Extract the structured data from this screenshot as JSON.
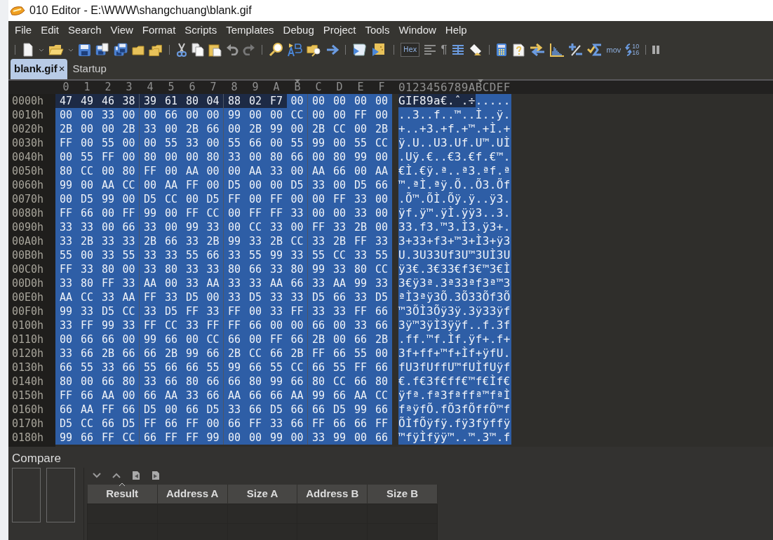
{
  "window": {
    "title": "010 Editor - E:\\WWW\\shangchuang\\blank.gif"
  },
  "menu": [
    "File",
    "Edit",
    "Search",
    "View",
    "Format",
    "Scripts",
    "Templates",
    "Debug",
    "Project",
    "Tools",
    "Window",
    "Help"
  ],
  "toolbar": {
    "hex_toggle": {
      "label": "Hex",
      "on": true
    },
    "pilcrow": "¶",
    "mov_label": "mov",
    "base_labels": [
      "10",
      "16"
    ]
  },
  "tabs": [
    {
      "label": "blank.gif",
      "selected": true,
      "close": "×"
    },
    {
      "label": "Startup",
      "selected": false
    }
  ],
  "hex_view": {
    "selected": true,
    "column_headers": [
      {
        "label": "0",
        "cursor": false
      },
      {
        "label": "1",
        "cursor": false
      },
      {
        "label": "2",
        "cursor": false
      },
      {
        "label": "3",
        "cursor": false
      },
      {
        "label": "4",
        "cursor": false
      },
      {
        "label": "5",
        "cursor": false
      },
      {
        "label": "6",
        "cursor": false
      },
      {
        "label": "7",
        "cursor": false
      },
      {
        "label": "8",
        "cursor": false
      },
      {
        "label": "9",
        "cursor": false
      },
      {
        "label": "A",
        "cursor": false
      },
      {
        "label": "B",
        "cursor": true
      },
      {
        "label": "C",
        "cursor": false
      },
      {
        "label": "D",
        "cursor": false
      },
      {
        "label": "E",
        "cursor": false
      },
      {
        "label": "F",
        "cursor": false
      }
    ],
    "ascii_header": "0123456789ABCDEF",
    "rows": [
      {
        "offset": "0000h",
        "marked_bytes": [
          "47",
          "49",
          "46",
          "38",
          "39",
          "61",
          "80",
          "04",
          "88",
          "02",
          "F7"
        ],
        "bytes": [
          "00",
          "00",
          "00",
          "00",
          "00"
        ],
        "ascii_marked": "GIF89a€.ˆ.÷",
        "ascii": "....."
      },
      {
        "offset": "0010h",
        "bytes": [
          "00",
          "00",
          "33",
          "00",
          "00",
          "66",
          "00",
          "00",
          "99",
          "00",
          "00",
          "CC",
          "00",
          "00",
          "FF",
          "00"
        ],
        "ascii": "..3..f..™..Ì..ÿ."
      },
      {
        "offset": "0020h",
        "bytes": [
          "2B",
          "00",
          "00",
          "2B",
          "33",
          "00",
          "2B",
          "66",
          "00",
          "2B",
          "99",
          "00",
          "2B",
          "CC",
          "00",
          "2B"
        ],
        "ascii": "+..+3.+f.+™.+Ì.+"
      },
      {
        "offset": "0030h",
        "bytes": [
          "FF",
          "00",
          "55",
          "00",
          "00",
          "55",
          "33",
          "00",
          "55",
          "66",
          "00",
          "55",
          "99",
          "00",
          "55",
          "CC"
        ],
        "ascii": "ÿ.U..U3.Uf.U™.UÌ"
      },
      {
        "offset": "0040h",
        "bytes": [
          "00",
          "55",
          "FF",
          "00",
          "80",
          "00",
          "00",
          "80",
          "33",
          "00",
          "80",
          "66",
          "00",
          "80",
          "99",
          "00"
        ],
        "ascii": ".Uÿ.€..€3.€f.€™."
      },
      {
        "offset": "0050h",
        "bytes": [
          "80",
          "CC",
          "00",
          "80",
          "FF",
          "00",
          "AA",
          "00",
          "00",
          "AA",
          "33",
          "00",
          "AA",
          "66",
          "00",
          "AA"
        ],
        "ascii": "€Ì.€ÿ.ª..ª3.ªf.ª"
      },
      {
        "offset": "0060h",
        "bytes": [
          "99",
          "00",
          "AA",
          "CC",
          "00",
          "AA",
          "FF",
          "00",
          "D5",
          "00",
          "00",
          "D5",
          "33",
          "00",
          "D5",
          "66"
        ],
        "ascii": "™.ªÌ.ªÿ.Õ..Õ3.Õf"
      },
      {
        "offset": "0070h",
        "bytes": [
          "00",
          "D5",
          "99",
          "00",
          "D5",
          "CC",
          "00",
          "D5",
          "FF",
          "00",
          "FF",
          "00",
          "00",
          "FF",
          "33",
          "00"
        ],
        "ascii": ".Õ™.ÕÌ.Õÿ.ÿ..ÿ3."
      },
      {
        "offset": "0080h",
        "bytes": [
          "FF",
          "66",
          "00",
          "FF",
          "99",
          "00",
          "FF",
          "CC",
          "00",
          "FF",
          "FF",
          "33",
          "00",
          "00",
          "33",
          "00"
        ],
        "ascii": "ÿf.ÿ™.ÿÌ.ÿÿ3..3."
      },
      {
        "offset": "0090h",
        "bytes": [
          "33",
          "33",
          "00",
          "66",
          "33",
          "00",
          "99",
          "33",
          "00",
          "CC",
          "33",
          "00",
          "FF",
          "33",
          "2B",
          "00"
        ],
        "ascii": "33.f3.™3.Ì3.ÿ3+."
      },
      {
        "offset": "00A0h",
        "bytes": [
          "33",
          "2B",
          "33",
          "33",
          "2B",
          "66",
          "33",
          "2B",
          "99",
          "33",
          "2B",
          "CC",
          "33",
          "2B",
          "FF",
          "33"
        ],
        "ascii": "3+33+f3+™3+Ì3+ÿ3"
      },
      {
        "offset": "00B0h",
        "bytes": [
          "55",
          "00",
          "33",
          "55",
          "33",
          "33",
          "55",
          "66",
          "33",
          "55",
          "99",
          "33",
          "55",
          "CC",
          "33",
          "55"
        ],
        "ascii": "U.3U33Uf3U™3UÌ3U"
      },
      {
        "offset": "00C0h",
        "bytes": [
          "FF",
          "33",
          "80",
          "00",
          "33",
          "80",
          "33",
          "33",
          "80",
          "66",
          "33",
          "80",
          "99",
          "33",
          "80",
          "CC"
        ],
        "ascii": "ÿ3€.3€33€f3€™3€Ì"
      },
      {
        "offset": "00D0h",
        "bytes": [
          "33",
          "80",
          "FF",
          "33",
          "AA",
          "00",
          "33",
          "AA",
          "33",
          "33",
          "AA",
          "66",
          "33",
          "AA",
          "99",
          "33"
        ],
        "ascii": "3€ÿ3ª.3ª33ªf3ª™3"
      },
      {
        "offset": "00E0h",
        "bytes": [
          "AA",
          "CC",
          "33",
          "AA",
          "FF",
          "33",
          "D5",
          "00",
          "33",
          "D5",
          "33",
          "33",
          "D5",
          "66",
          "33",
          "D5"
        ],
        "ascii": "ªÌ3ªÿ3Õ.3Õ33Õf3Õ"
      },
      {
        "offset": "00F0h",
        "bytes": [
          "99",
          "33",
          "D5",
          "CC",
          "33",
          "D5",
          "FF",
          "33",
          "FF",
          "00",
          "33",
          "FF",
          "33",
          "33",
          "FF",
          "66"
        ],
        "ascii": "™3ÕÌ3Õÿ3ÿ.3ÿ33ÿf"
      },
      {
        "offset": "0100h",
        "bytes": [
          "33",
          "FF",
          "99",
          "33",
          "FF",
          "CC",
          "33",
          "FF",
          "FF",
          "66",
          "00",
          "00",
          "66",
          "00",
          "33",
          "66"
        ],
        "ascii": "3ÿ™3ÿÌ3ÿÿf..f.3f"
      },
      {
        "offset": "0110h",
        "bytes": [
          "00",
          "66",
          "66",
          "00",
          "99",
          "66",
          "00",
          "CC",
          "66",
          "00",
          "FF",
          "66",
          "2B",
          "00",
          "66",
          "2B"
        ],
        "ascii": ".ff.™f.Ìf.ÿf+.f+"
      },
      {
        "offset": "0120h",
        "bytes": [
          "33",
          "66",
          "2B",
          "66",
          "66",
          "2B",
          "99",
          "66",
          "2B",
          "CC",
          "66",
          "2B",
          "FF",
          "66",
          "55",
          "00"
        ],
        "ascii": "3f+ff+™f+Ìf+ÿfU."
      },
      {
        "offset": "0130h",
        "bytes": [
          "66",
          "55",
          "33",
          "66",
          "55",
          "66",
          "66",
          "55",
          "99",
          "66",
          "55",
          "CC",
          "66",
          "55",
          "FF",
          "66"
        ],
        "ascii": "fU3fUffU™fUÌfUÿf"
      },
      {
        "offset": "0140h",
        "bytes": [
          "80",
          "00",
          "66",
          "80",
          "33",
          "66",
          "80",
          "66",
          "66",
          "80",
          "99",
          "66",
          "80",
          "CC",
          "66",
          "80"
        ],
        "ascii": "€.f€3f€ff€™f€Ìf€"
      },
      {
        "offset": "0150h",
        "bytes": [
          "FF",
          "66",
          "AA",
          "00",
          "66",
          "AA",
          "33",
          "66",
          "AA",
          "66",
          "66",
          "AA",
          "99",
          "66",
          "AA",
          "CC"
        ],
        "ascii": "ÿfª.fª3fªffª™fªÌ"
      },
      {
        "offset": "0160h",
        "bytes": [
          "66",
          "AA",
          "FF",
          "66",
          "D5",
          "00",
          "66",
          "D5",
          "33",
          "66",
          "D5",
          "66",
          "66",
          "D5",
          "99",
          "66"
        ],
        "ascii": "fªÿfÕ.fÕ3fÕffÕ™f"
      },
      {
        "offset": "0170h",
        "bytes": [
          "D5",
          "CC",
          "66",
          "D5",
          "FF",
          "66",
          "FF",
          "00",
          "66",
          "FF",
          "33",
          "66",
          "FF",
          "66",
          "66",
          "FF"
        ],
        "ascii": "ÕÌfÕÿfÿ.fÿ3fÿffÿ"
      },
      {
        "offset": "0180h",
        "bytes": [
          "99",
          "66",
          "FF",
          "CC",
          "66",
          "FF",
          "FF",
          "99",
          "00",
          "00",
          "99",
          "00",
          "33",
          "99",
          "00",
          "66"
        ],
        "ascii": "™fÿÌfÿÿ™..™.3™.f"
      }
    ]
  },
  "compare": {
    "title": "Compare",
    "table": {
      "columns": [
        {
          "label": "Result",
          "sorted": true
        },
        {
          "label": "Address A",
          "sorted": false
        },
        {
          "label": "Size A",
          "sorted": false
        },
        {
          "label": "Address B",
          "sorted": false
        },
        {
          "label": "Size B",
          "sorted": false
        }
      ]
    }
  }
}
